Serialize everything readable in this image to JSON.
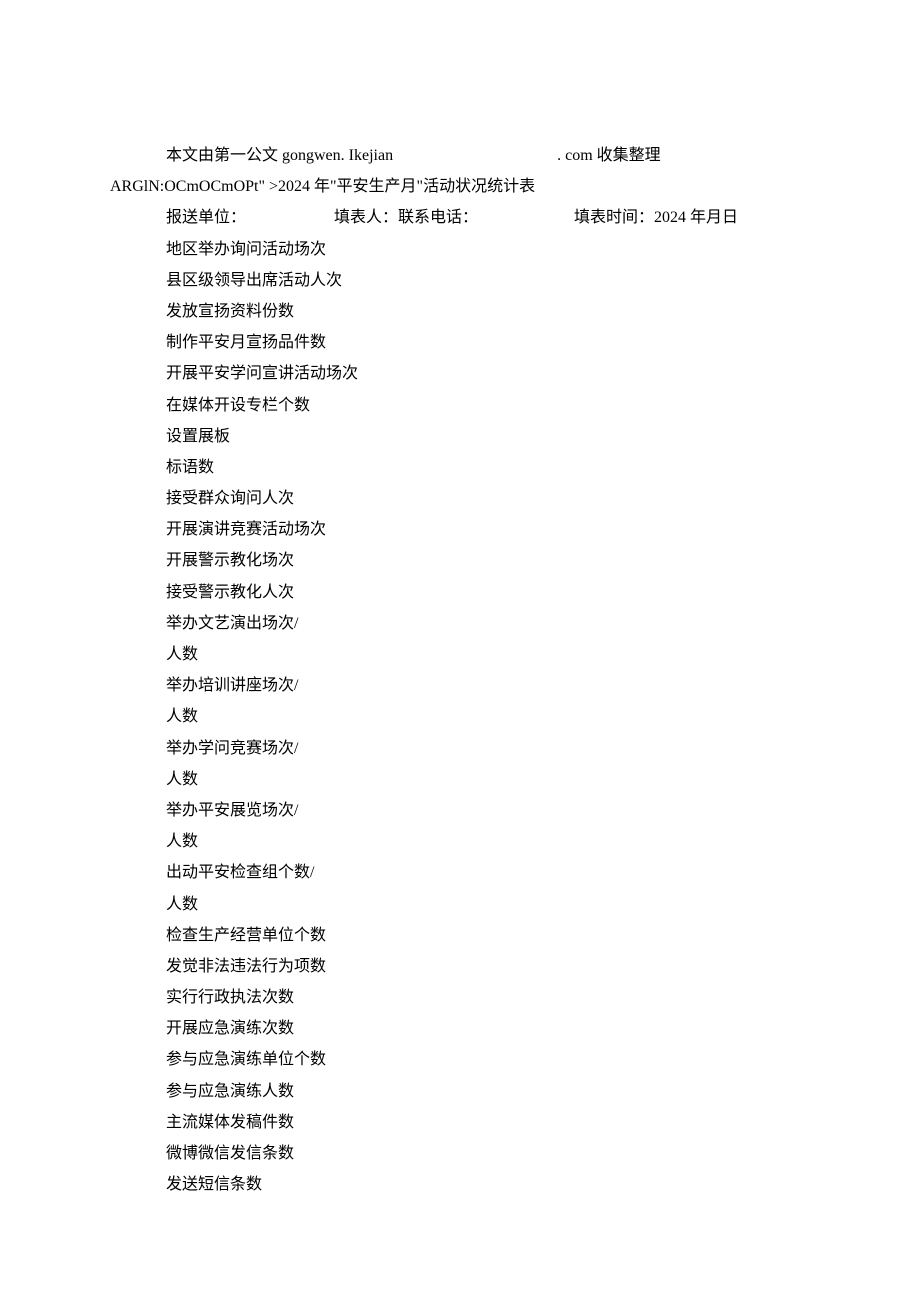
{
  "header": {
    "source_prefix": "本文由第一公文 gongwen. Ikejian",
    "source_suffix": ". com 收集整理",
    "margin_code": "ARGlN:OCmOCmOPt\" >2024 年\"平安生产月\"活动状况统计表"
  },
  "info": {
    "report_unit_label": "报送单位：",
    "filler_label": "填表人：联系电话：",
    "fill_time_label": "填表时间：2024 年月日"
  },
  "items": [
    "地区举办询问活动场次",
    "县区级领导出席活动人次",
    "发放宣扬资料份数",
    "制作平安月宣扬品件数",
    "开展平安学问宣讲活动场次",
    "在媒体开设专栏个数",
    "设置展板",
    "标语数",
    "接受群众询问人次",
    "开展演讲竞赛活动场次",
    "开展警示教化场次",
    "接受警示教化人次",
    "举办文艺演出场次/",
    "人数",
    "举办培训讲座场次/",
    "人数",
    "举办学问竞赛场次/",
    "人数",
    "举办平安展览场次/",
    "人数",
    "出动平安检查组个数/",
    "人数",
    "检查生产经营单位个数",
    "发觉非法违法行为项数",
    "实行行政执法次数",
    "开展应急演练次数",
    "参与应急演练单位个数",
    "参与应急演练人数",
    "主流媒体发稿件数",
    "微博微信发信条数",
    "发送短信条数"
  ]
}
